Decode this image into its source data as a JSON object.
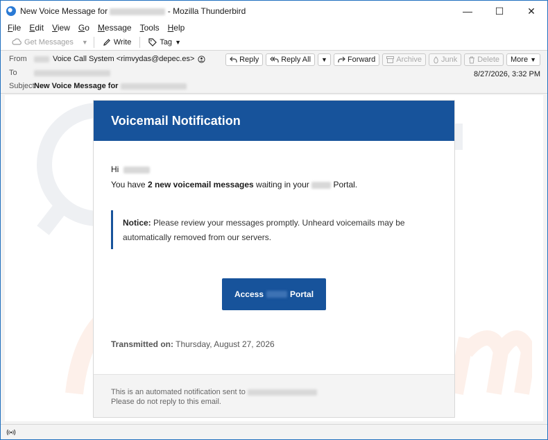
{
  "window": {
    "title_prefix": "New Voice Message for",
    "title_suffix": "- Mozilla Thunderbird",
    "controls": {
      "minimize": "—",
      "maximize": "☐",
      "close": "✕"
    }
  },
  "menu": {
    "items": [
      {
        "key": "F",
        "rest": "ile"
      },
      {
        "key": "E",
        "rest": "dit"
      },
      {
        "key": "V",
        "rest": "iew"
      },
      {
        "key": "G",
        "rest": "o"
      },
      {
        "key": "M",
        "rest": "essage"
      },
      {
        "key": "T",
        "rest": "ools"
      },
      {
        "key": "H",
        "rest": "elp"
      }
    ]
  },
  "toolbar": {
    "get_messages": "Get Messages",
    "write": "Write",
    "tag": "Tag"
  },
  "headers": {
    "from_label": "From",
    "from_value": "Voice Call System <rimvydas@depec.es>",
    "to_label": "To",
    "subject_label": "Subject",
    "subject_value": "New Voice Message for",
    "date": "8/27/2026, 3:32 PM"
  },
  "actions": {
    "reply": "Reply",
    "reply_all": "Reply All",
    "forward": "Forward",
    "archive": "Archive",
    "junk": "Junk",
    "delete": "Delete",
    "more": "More"
  },
  "email": {
    "header_title": "Voicemail Notification",
    "greeting": "Hi",
    "line_pre": "You have ",
    "line_bold": "2 new voicemail messages",
    "line_mid": " waiting in your",
    "line_post": "Portal.",
    "notice_label": "Notice:",
    "notice_text": " Please review your messages promptly. Unheard voicemails may be automatically removed from our servers.",
    "cta_left": "Access",
    "cta_right": "Portal",
    "transmitted_label": "Transmitted on:",
    "transmitted_value": " Thursday, August 27, 2026",
    "footer_line1": "This is an automated notification sent to",
    "footer_line2": "Please do not reply to this email."
  },
  "colors": {
    "accent": "#17539b",
    "window_border": "#1f6fbf"
  }
}
